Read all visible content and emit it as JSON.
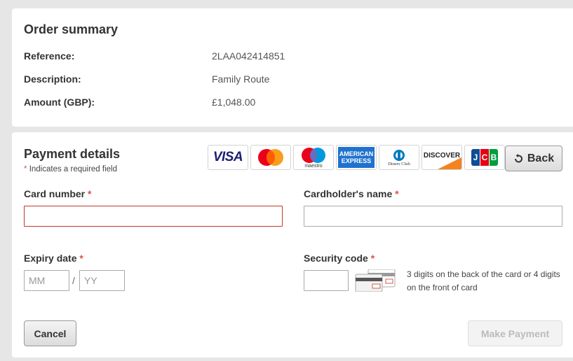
{
  "summary": {
    "title": "Order summary",
    "rows": [
      {
        "label": "Reference:",
        "value": "2LAA042414851"
      },
      {
        "label": "Description:",
        "value": "Family Route"
      },
      {
        "label": "Amount (GBP):",
        "value": "£1,048.00"
      }
    ]
  },
  "payment": {
    "title": "Payment details",
    "required_marker": "*",
    "required_note": "Indicates a required field",
    "card_logos": [
      {
        "name": "visa",
        "text": "VISA"
      },
      {
        "name": "mastercard"
      },
      {
        "name": "maestro",
        "text": "maestro"
      },
      {
        "name": "american-express",
        "text_top": "AMERICAN",
        "text_bottom": "EXPRESS"
      },
      {
        "name": "diners-club",
        "text": "Diners Club"
      },
      {
        "name": "discover",
        "text": "DISCOVER"
      },
      {
        "name": "jcb",
        "text": "JCB"
      }
    ],
    "back_label": "Back",
    "card_number_label": "Card number",
    "cardholder_label": "Cardholder's name",
    "expiry_label": "Expiry date",
    "expiry_month_placeholder": "MM",
    "expiry_separator": "/",
    "expiry_year_placeholder": "YY",
    "security_label": "Security code",
    "security_hint": "3 digits on the back of the card or 4 digits on the front of card",
    "cancel_label": "Cancel",
    "make_payment_label": "Make Payment"
  },
  "colors": {
    "required": "#d9534f",
    "error_border": "#c0392b",
    "page_background": "#e6e6e6"
  }
}
